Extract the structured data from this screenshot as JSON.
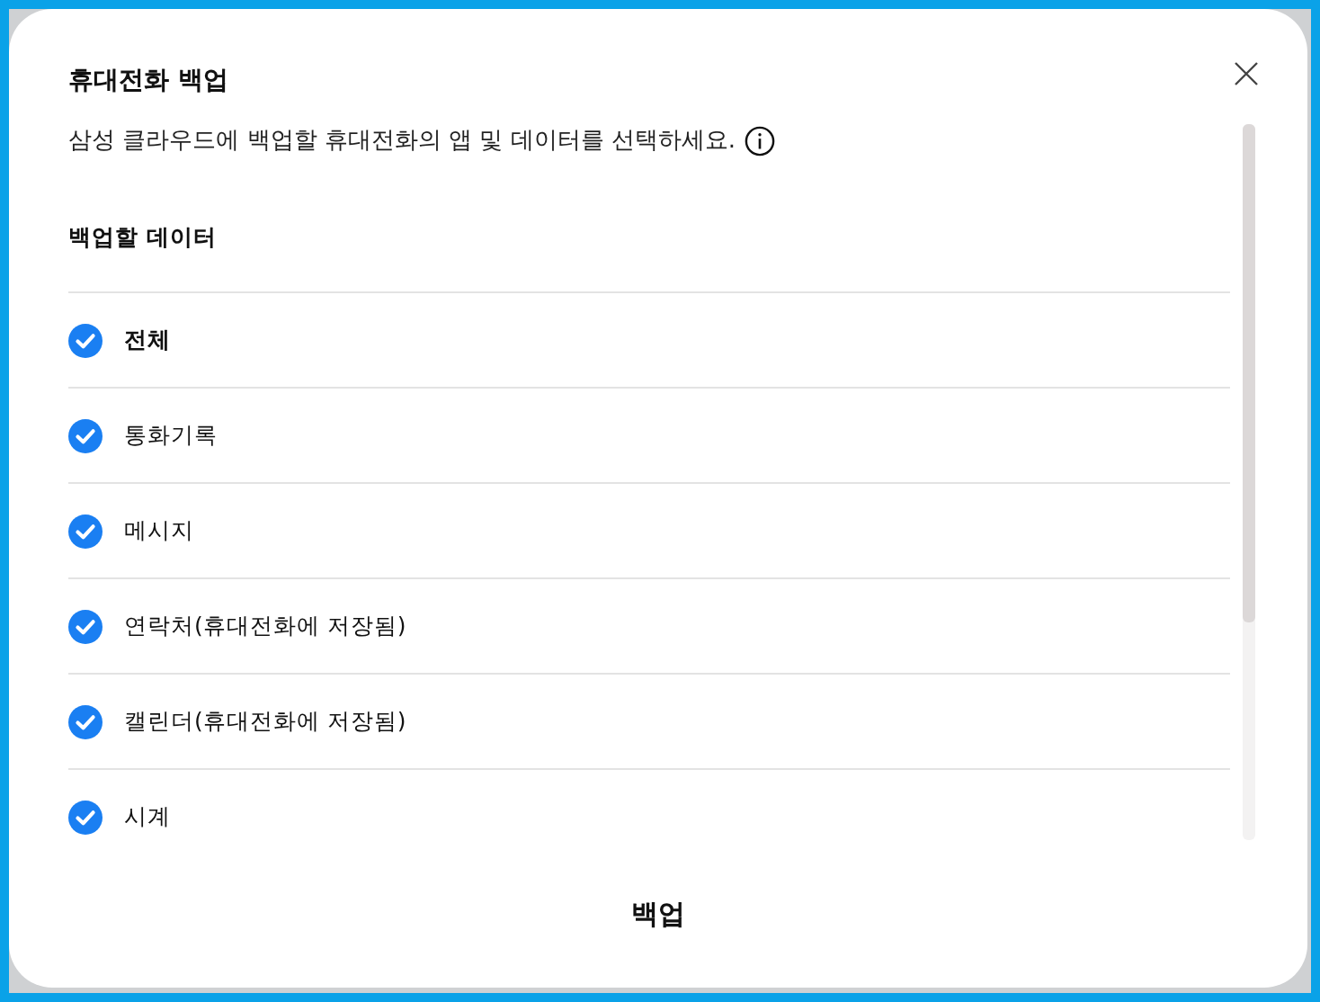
{
  "dialog": {
    "title": "휴대전화 백업",
    "description": "삼성 클라우드에 백업할 휴대전화의 앱 및 데이터를 선택하세요.",
    "section_title": "백업할 데이터",
    "items": [
      {
        "label": "전체",
        "kind": "all",
        "checked": true
      },
      {
        "label": "통화기록",
        "kind": "item",
        "checked": true
      },
      {
        "label": "메시지",
        "kind": "item",
        "checked": true
      },
      {
        "label": "연락처(휴대전화에 저장됨)",
        "kind": "item",
        "checked": true
      },
      {
        "label": "캘린더(휴대전화에 저장됨)",
        "kind": "item",
        "checked": true
      },
      {
        "label": "시계",
        "kind": "item",
        "checked": true
      }
    ],
    "button": "백업"
  }
}
